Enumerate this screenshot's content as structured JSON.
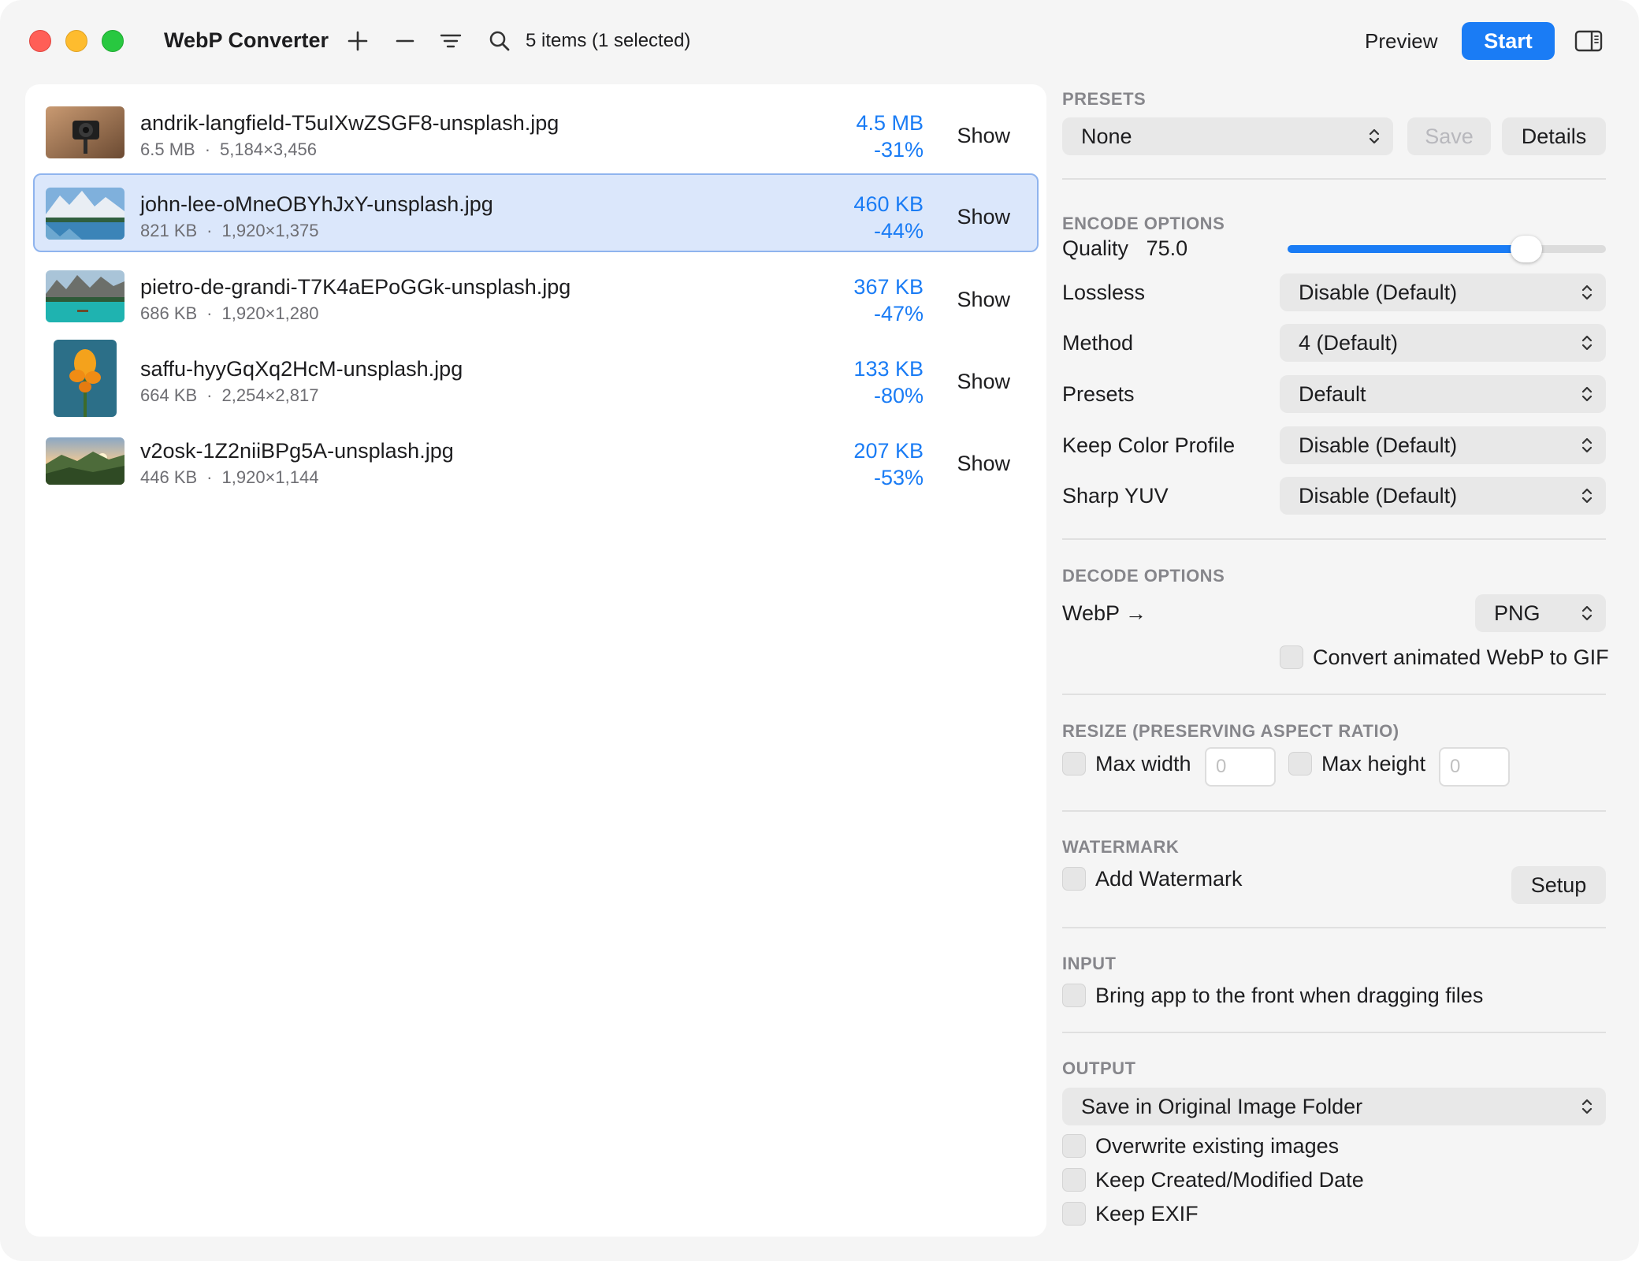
{
  "window": {
    "title": "WebP Converter"
  },
  "toolbar": {
    "add_icon": "plus-icon",
    "remove_icon": "minus-icon",
    "sort_icon": "sort-lines-icon",
    "search_icon": "search-icon",
    "item_count": "5 items (1 selected)",
    "preview_label": "Preview",
    "start_label": "Start",
    "accent_color": "#1a7cf5"
  },
  "files": [
    {
      "name": "andrik-langfield-T5uIXwZSGF8-unsplash.jpg",
      "orig_size": "6.5 MB",
      "dims": "5,184×3,456",
      "new_size": "4.5 MB",
      "change": "-31%",
      "show_label": "Show",
      "selected": false
    },
    {
      "name": "john-lee-oMneOBYhJxY-unsplash.jpg",
      "orig_size": "821 KB",
      "dims": "1,920×1,375",
      "new_size": "460 KB",
      "change": "-44%",
      "show_label": "Show",
      "selected": true
    },
    {
      "name": "pietro-de-grandi-T7K4aEPoGGk-unsplash.jpg",
      "orig_size": "686 KB",
      "dims": "1,920×1,280",
      "new_size": "367 KB",
      "change": "-47%",
      "show_label": "Show",
      "selected": false
    },
    {
      "name": "saffu-hyyGqXq2HcM-unsplash.jpg",
      "orig_size": "664 KB",
      "dims": "2,254×2,817",
      "new_size": "133 KB",
      "change": "-80%",
      "show_label": "Show",
      "selected": false
    },
    {
      "name": "v2osk-1Z2niiBPg5A-unsplash.jpg",
      "orig_size": "446 KB",
      "dims": "1,920×1,144",
      "new_size": "207 KB",
      "change": "-53%",
      "show_label": "Show",
      "selected": false
    }
  ],
  "panel": {
    "presets": {
      "heading": "PRESETS",
      "selected": "None",
      "save_label": "Save",
      "details_label": "Details"
    },
    "encode": {
      "heading": "ENCODE OPTIONS",
      "quality_label": "Quality",
      "quality_value": "75.0",
      "quality_fraction": 0.75,
      "lossless_label": "Lossless",
      "lossless_value": "Disable (Default)",
      "method_label": "Method",
      "method_value": "4 (Default)",
      "presets_label": "Presets",
      "presets_value": "Default",
      "color_profile_label": "Keep Color Profile",
      "color_profile_value": "Disable (Default)",
      "sharp_yuv_label": "Sharp YUV",
      "sharp_yuv_value": "Disable (Default)"
    },
    "decode": {
      "heading": "DECODE OPTIONS",
      "webp_label": "WebP →",
      "format_value": "PNG",
      "animated_label": "Convert animated WebP to GIF"
    },
    "resize": {
      "heading": "RESIZE (PRESERVING ASPECT RATIO)",
      "max_width_label": "Max width",
      "max_width_placeholder": "0",
      "max_height_label": "Max height",
      "max_height_placeholder": "0"
    },
    "watermark": {
      "heading": "WATERMARK",
      "add_label": "Add Watermark",
      "setup_label": "Setup"
    },
    "input": {
      "heading": "INPUT",
      "bring_front_label": "Bring app to the front when dragging files"
    },
    "output": {
      "heading": "OUTPUT",
      "location_value": "Save in Original Image Folder",
      "overwrite_label": "Overwrite existing images",
      "keep_date_label": "Keep Created/Modified Date",
      "keep_exif_label": "Keep EXIF"
    }
  }
}
